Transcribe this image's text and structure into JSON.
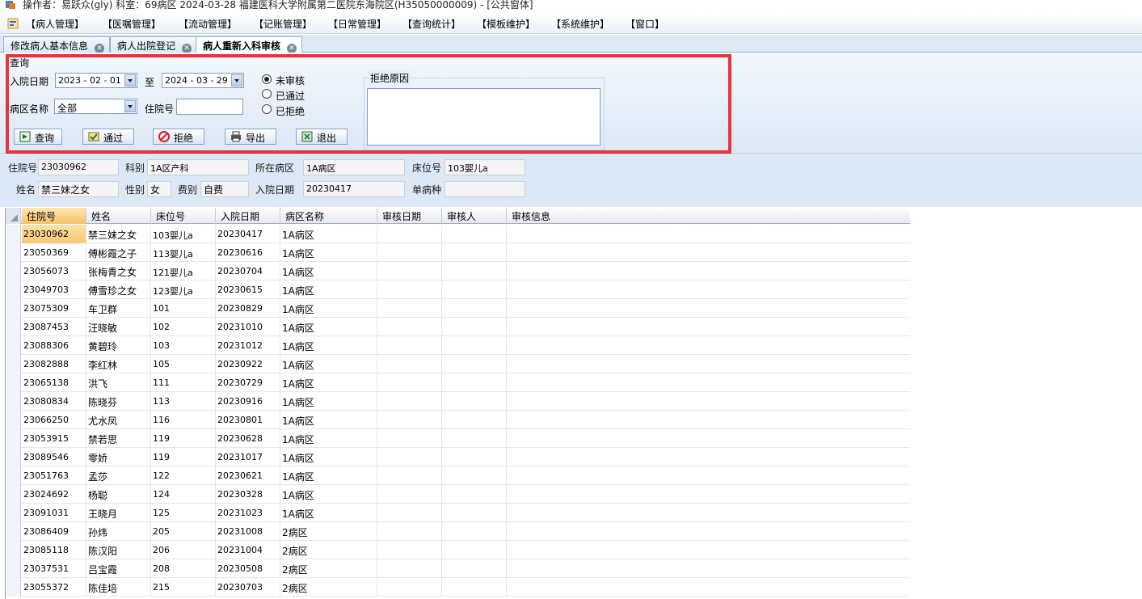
{
  "titlebar": {
    "text": "操作者：易跃众(gly)  科室：69病区  2024-03-28  福建医科大学附属第二医院东海院区(H35050000009) - [公共窗体]"
  },
  "menu": [
    "【病人管理】",
    "【医嘱管理】",
    "【流动管理】",
    "【记账管理】",
    "【日常管理】",
    "【查询统计】",
    "【模板维护】",
    "【系统维护】",
    "【窗口】"
  ],
  "tabs": [
    {
      "label": "修改病人基本信息",
      "active": false
    },
    {
      "label": "病人出院登记",
      "active": false
    },
    {
      "label": "病人重新入科审核",
      "active": true
    }
  ],
  "query": {
    "group_label": "查询",
    "admit_date_label": "入院日期",
    "date_from": "2023 - 02 - 01",
    "to_label": "至",
    "date_to": "2024 - 03 - 29",
    "ward_label": "病区名称",
    "ward_value": "全部",
    "inpatient_no_label": "住院号",
    "inpatient_no_value": "",
    "status_options": [
      "未审核",
      "已通过",
      "已拒绝"
    ],
    "status_selected": 0,
    "reject_reason_label": "拒绝原因",
    "reject_reason_value": "",
    "buttons": {
      "query": "查询",
      "approve": "通过",
      "reject": "拒绝",
      "export": "导出",
      "exit": "退出"
    }
  },
  "detail": {
    "inpatient_no_label": "住院号",
    "inpatient_no": "23030962",
    "dept_label": "科别",
    "dept": "1A区产科",
    "ward_label": "所在病区",
    "ward": "1A病区",
    "bed_label": "床位号",
    "bed": "103婴儿a",
    "name_label": "姓名",
    "name": "禁三妹之女",
    "gender_label": "性别",
    "gender": "女",
    "fee_label": "费别",
    "fee": "自费",
    "admit_date_label": "入院日期",
    "admit_date": "20230417",
    "single_disease_label": "单病种",
    "single_disease": ""
  },
  "grid": {
    "columns": [
      "住院号",
      "姓名",
      "床位号",
      "入院日期",
      "病区名称",
      "审核日期",
      "审核人",
      "审核信息"
    ],
    "rows": [
      [
        "23030962",
        "禁三妹之女",
        "103婴儿a",
        "20230417",
        "1A病区",
        "",
        "",
        ""
      ],
      [
        "23050369",
        "傅彬霞之子",
        "113婴儿a",
        "20230616",
        "1A病区",
        "",
        "",
        ""
      ],
      [
        "23056073",
        "张梅青之女",
        "121婴儿a",
        "20230704",
        "1A病区",
        "",
        "",
        ""
      ],
      [
        "23049703",
        "傅雪珍之女",
        "123婴儿a",
        "20230615",
        "1A病区",
        "",
        "",
        ""
      ],
      [
        "23075309",
        "车卫群",
        "101",
        "20230829",
        "1A病区",
        "",
        "",
        ""
      ],
      [
        "23087453",
        "汪晓敏",
        "102",
        "20231010",
        "1A病区",
        "",
        "",
        ""
      ],
      [
        "23088306",
        "黄碧玲",
        "103",
        "20231012",
        "1A病区",
        "",
        "",
        ""
      ],
      [
        "23082888",
        "李红林",
        "105",
        "20230922",
        "1A病区",
        "",
        "",
        ""
      ],
      [
        "23065138",
        "洪飞",
        "111",
        "20230729",
        "1A病区",
        "",
        "",
        ""
      ],
      [
        "23080834",
        "陈晓芬",
        "113",
        "20230916",
        "1A病区",
        "",
        "",
        ""
      ],
      [
        "23066250",
        "尤水凤",
        "116",
        "20230801",
        "1A病区",
        "",
        "",
        ""
      ],
      [
        "23053915",
        "禁若思",
        "119",
        "20230628",
        "1A病区",
        "",
        "",
        ""
      ],
      [
        "23089546",
        "零娇",
        "119",
        "20231017",
        "1A病区",
        "",
        "",
        ""
      ],
      [
        "23051763",
        "孟莎",
        "122",
        "20230621",
        "1A病区",
        "",
        "",
        ""
      ],
      [
        "23024692",
        "杨聪",
        "124",
        "20230328",
        "1A病区",
        "",
        "",
        ""
      ],
      [
        "23091031",
        "王晓月",
        "125",
        "20231023",
        "1A病区",
        "",
        "",
        ""
      ],
      [
        "23086409",
        "孙炜",
        "205",
        "20231008",
        "2病区",
        "",
        "",
        ""
      ],
      [
        "23085118",
        "陈汉阳",
        "206",
        "20231004",
        "2病区",
        "",
        "",
        ""
      ],
      [
        "23037531",
        "吕宝霞",
        "208",
        "20230508",
        "2病区",
        "",
        "",
        ""
      ],
      [
        "23055372",
        "陈佳培",
        "215",
        "20230703",
        "2病区",
        "",
        "",
        ""
      ]
    ]
  },
  "colors": {
    "highlight_frame": "#e8343a",
    "panel_bg": "#dce8f5",
    "current_cell": "#f9c76f"
  }
}
